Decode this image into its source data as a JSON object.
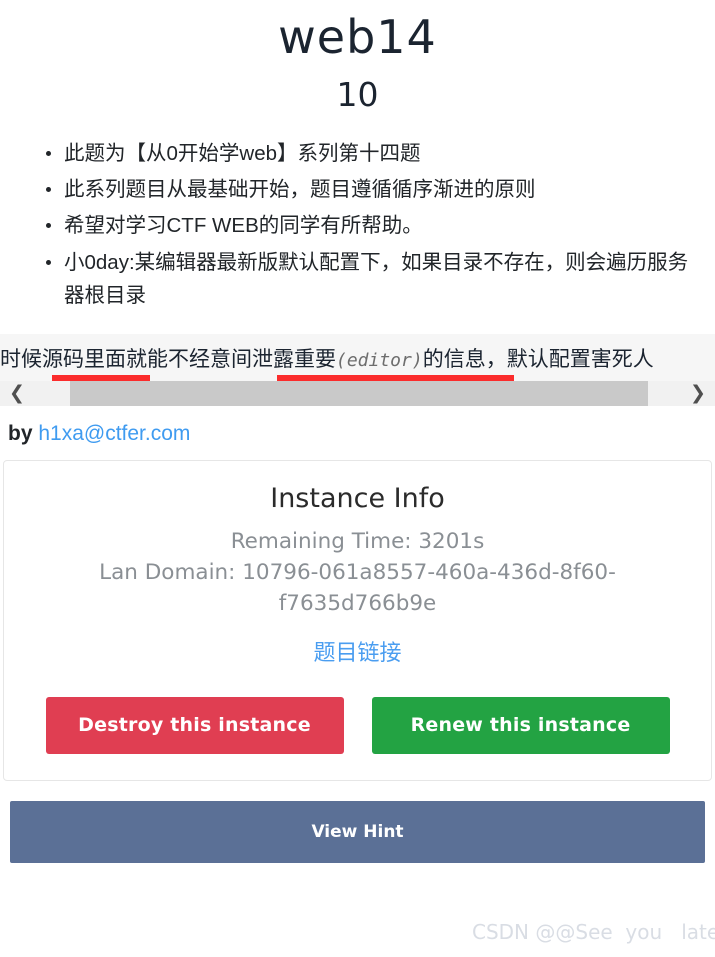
{
  "header": {
    "title": "web14",
    "subtitle": "10"
  },
  "description": {
    "items": [
      "此题为【从0开始学web】系列第十四题",
      "此系列题目从最基础开始，题目遵循循序渐进的原则",
      "希望对学习CTF WEB的同学有所帮助。",
      "小0day:某编辑器最新版默认配置下，如果目录不存在，则会遍历服务器根目录"
    ]
  },
  "code_block": {
    "text_before": "时候源码里面就能不经意间泄露重要",
    "text_mono": "(editor)",
    "text_after": "的信息，默认配置害死人",
    "highlight_color": "#fb2c2c",
    "scrollbar": {
      "left_arrow": "❮",
      "right_arrow": "❯"
    }
  },
  "byline": {
    "prefix": "by ",
    "email": "h1xa@ctfer.com"
  },
  "instance": {
    "title": "Instance Info",
    "remaining_time": "Remaining Time: 3201s",
    "lan_domain": "Lan Domain: 10796-061a8557-460a-436d-8f60-f7635d766b9e",
    "challenge_link": "题目链接",
    "destroy_label": "Destroy this instance",
    "renew_label": "Renew this instance",
    "destroy_color": "#e03e52",
    "renew_color": "#23a343"
  },
  "hint": {
    "label": "View Hint",
    "color": "#5b7096"
  },
  "watermark": {
    "text": "CSDN @@See  you   later"
  }
}
